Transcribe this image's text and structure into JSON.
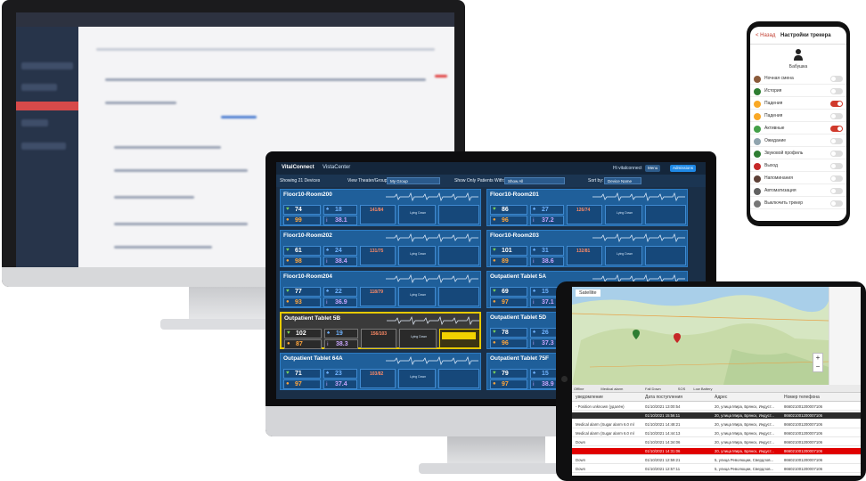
{
  "phone": {
    "back": "< Назад",
    "title": "Настройки трекера",
    "user_name": "Бабушка",
    "rows": [
      {
        "label": "Ночная смена",
        "on": false,
        "color": "#8a5a3a"
      },
      {
        "label": "История",
        "on": false,
        "color": "#2e7d32"
      },
      {
        "label": "Падения",
        "on": true,
        "color": "#f9a825"
      },
      {
        "label": "Падения",
        "on": false,
        "color": "#f9a825"
      },
      {
        "label": "Активные",
        "on": true,
        "color": "#43a047"
      },
      {
        "label": "Ожидание",
        "on": false,
        "color": "#90a4ae"
      },
      {
        "label": "Звуковой профиль",
        "on": false,
        "color": "#2e7d32"
      },
      {
        "label": "Выход",
        "on": false,
        "color": "#c62828"
      },
      {
        "label": "Напоминания",
        "on": false,
        "color": "#5d4037"
      },
      {
        "label": "Автоматизация",
        "on": false,
        "color": "#616161"
      },
      {
        "label": "Выключить трекер",
        "on": false,
        "color": "#757575"
      }
    ]
  },
  "vista": {
    "logo": "VitalConnect",
    "center": "VistaCenter",
    "user": "Hi vitalconnect",
    "menu_label": "Menu",
    "action_label": "Admissions",
    "showing": "Showing 21 Devices",
    "view_label": "View Theater/Group:",
    "view_value": "My Group",
    "only_label": "Show Only Patients With:",
    "only_value": "Show All",
    "sort_label": "Sort by:",
    "sort_value": "Device Name",
    "cards": [
      {
        "name": "Floor10-Room200",
        "hr": "74",
        "rr": "18",
        "spo2": "99",
        "temp": "38.1",
        "bp": "141/84",
        "pos": "Lying Down",
        "alert": false
      },
      {
        "name": "Floor10-Room201",
        "hr": "86",
        "rr": "27",
        "spo2": "96",
        "temp": "37.2",
        "bp": "126/74",
        "pos": "Lying Down",
        "alert": false
      },
      {
        "name": "Floor10-Room202",
        "hr": "61",
        "rr": "24",
        "spo2": "98",
        "temp": "38.4",
        "bp": "131/75",
        "pos": "Lying Down",
        "alert": false
      },
      {
        "name": "Floor10-Room203",
        "hr": "101",
        "rr": "31",
        "spo2": "89",
        "temp": "38.6",
        "bp": "132/81",
        "pos": "Lying Down",
        "alert": false
      },
      {
        "name": "Floor10-Room204",
        "hr": "77",
        "rr": "22",
        "spo2": "93",
        "temp": "36.9",
        "bp": "118/79",
        "pos": "Lying Down",
        "alert": false
      },
      {
        "name": "Outpatient Tablet 5A",
        "hr": "69",
        "rr": "15",
        "spo2": "97",
        "temp": "37.1",
        "bp": "",
        "pos": "",
        "alert": false
      },
      {
        "name": "Outpatient Tablet 5B",
        "hr": "102",
        "rr": "19",
        "spo2": "87",
        "temp": "38.3",
        "bp": "156/103",
        "pos": "Lying Down",
        "alert": true
      },
      {
        "name": "Outpatient Tablet 5D",
        "hr": "78",
        "rr": "26",
        "spo2": "96",
        "temp": "37.3",
        "bp": "",
        "pos": "",
        "alert": false
      },
      {
        "name": "Outpatient Tablet 64A",
        "hr": "71",
        "rr": "23",
        "spo2": "97",
        "temp": "37.4",
        "bp": "103/82",
        "pos": "Lying Down",
        "alert": false
      },
      {
        "name": "Outpatient Tablet 75F",
        "hr": "79",
        "rr": "15",
        "spo2": "97",
        "temp": "38.9",
        "bp": "",
        "pos": "",
        "alert": false
      }
    ]
  },
  "tablet": {
    "map_tab": "Satellite",
    "filters": [
      "Offline",
      "Medical alarm",
      "Fall Down",
      "SOS",
      "Low Battery"
    ],
    "columns": [
      "уведомление",
      "Дата поступления",
      "Адрес",
      "Номер телефона"
    ],
    "rows": [
      {
        "event": "- Position unknown (удалён)",
        "date": "01/10/2021 13:00:54",
        "addr": "20, улица Мира, Брянск, Индуст...",
        "phone": "866021001200007106",
        "style": "normal"
      },
      {
        "event": "",
        "date": "01/10/2021 15:56:11",
        "addr": "20, улица Мира, Брянск, Индуст...",
        "phone": "866021001200007106",
        "style": "dark"
      },
      {
        "event": "Medical alarm (Sugar alarm 6.0 ml",
        "date": "01/10/2021 14:48:21",
        "addr": "20, улица Мира, Брянск, Индуст...",
        "phone": "866021001200007106",
        "style": "normal"
      },
      {
        "event": "Medical alarm (Sugar alarm 6.0 ml",
        "date": "01/10/2021 14:44:13",
        "addr": "20, улица Мира, Брянск, Индуст...",
        "phone": "866021001200007106",
        "style": "normal"
      },
      {
        "event": "Down",
        "date": "01/10/2021 14:34:06",
        "addr": "20, улица Мира, Брянск, Индуст...",
        "phone": "866021001200007106",
        "style": "normal"
      },
      {
        "event": "",
        "date": "01/10/2021 14:31:06",
        "addr": "20, улица Мира, Брянск, Индуст...",
        "phone": "866021001200007106",
        "style": "red"
      },
      {
        "event": "Down",
        "date": "01/10/2021 12:59:21",
        "addr": "5, улица Революции, Свердлов...",
        "phone": "866021001200007106",
        "style": "normal"
      },
      {
        "event": "Down",
        "date": "01/10/2021 12:57:11",
        "addr": "5, улица Революции, Свердлов...",
        "phone": "866021001200007106",
        "style": "normal"
      }
    ]
  }
}
